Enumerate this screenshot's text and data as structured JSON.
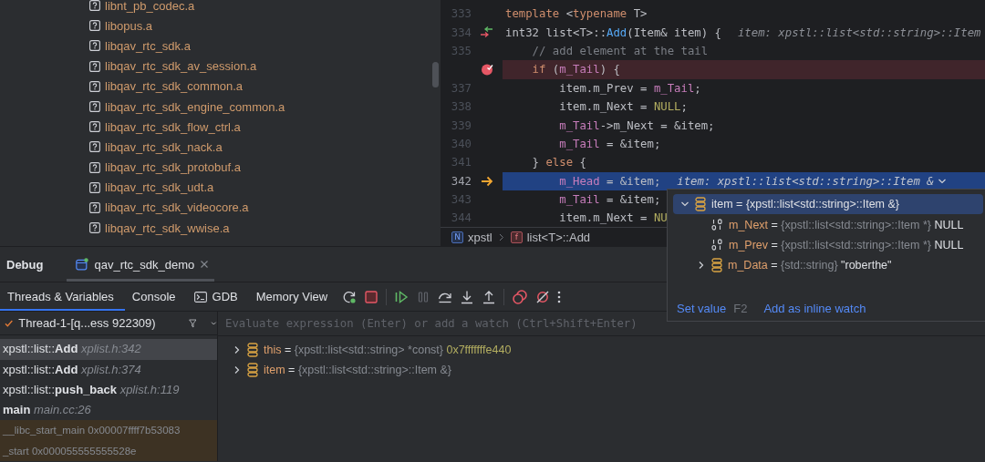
{
  "file_tree": {
    "items": [
      {
        "name": "libnt_pb_codec.a"
      },
      {
        "name": "libopus.a"
      },
      {
        "name": "libqav_rtc_sdk.a"
      },
      {
        "name": "libqav_rtc_sdk_av_session.a"
      },
      {
        "name": "libqav_rtc_sdk_common.a"
      },
      {
        "name": "libqav_rtc_sdk_engine_common.a"
      },
      {
        "name": "libqav_rtc_sdk_flow_ctrl.a"
      },
      {
        "name": "libqav_rtc_sdk_nack.a"
      },
      {
        "name": "libqav_rtc_sdk_protobuf.a"
      },
      {
        "name": "libqav_rtc_sdk_udt.a"
      },
      {
        "name": "libqav_rtc_sdk_videocore.a"
      },
      {
        "name": "libqav_rtc_sdk_wwise.a"
      }
    ]
  },
  "editor": {
    "lines": [
      {
        "number": "333",
        "kind": "plain",
        "segments": [
          {
            "kind": "keyword",
            "text": "template "
          },
          {
            "kind": "text",
            "text": "<"
          },
          {
            "kind": "keyword",
            "text": "typename"
          },
          {
            "kind": "text",
            "text": " T>"
          }
        ]
      },
      {
        "number": "334",
        "kind": "step",
        "segments": [
          {
            "kind": "text",
            "text": "int32 list<T>::"
          },
          {
            "kind": "function",
            "text": "Add"
          },
          {
            "kind": "text",
            "text": "(Item& item) {"
          }
        ],
        "hint": "item: xpstl::list<std::string>::Item",
        "hint_expandable": false
      },
      {
        "number": "335",
        "kind": "plain",
        "segments": [
          {
            "kind": "comment",
            "text": "    // add element at the tail"
          }
        ]
      },
      {
        "kind": "breakpoint",
        "segments": [
          {
            "kind": "keyword",
            "text": "    if "
          },
          {
            "kind": "text",
            "text": "("
          },
          {
            "kind": "field",
            "text": "m_Tail"
          },
          {
            "kind": "text",
            "text": ") {"
          }
        ]
      },
      {
        "number": "337",
        "kind": "plain",
        "segments": [
          {
            "kind": "text",
            "text": "        item.m_Prev = "
          },
          {
            "kind": "field",
            "text": "m_Tail"
          },
          {
            "kind": "text",
            "text": ";"
          }
        ]
      },
      {
        "number": "338",
        "kind": "plain",
        "segments": [
          {
            "kind": "text",
            "text": "        item.m_Next = "
          },
          {
            "kind": "constant",
            "text": "NULL"
          },
          {
            "kind": "text",
            "text": ";"
          }
        ]
      },
      {
        "number": "339",
        "kind": "plain",
        "segments": [
          {
            "kind": "field",
            "text": "        m_Tail"
          },
          {
            "kind": "text",
            "text": "->m_Next = &item;"
          }
        ]
      },
      {
        "number": "340",
        "kind": "plain",
        "segments": [
          {
            "kind": "field",
            "text": "        m_Tail"
          },
          {
            "kind": "text",
            "text": " = &item;"
          }
        ]
      },
      {
        "number": "341",
        "kind": "plain",
        "segments": [
          {
            "kind": "text",
            "text": "    } "
          },
          {
            "kind": "keyword",
            "text": "else"
          },
          {
            "kind": "text",
            "text": " {"
          }
        ]
      },
      {
        "number": "342",
        "kind": "execution",
        "segments": [
          {
            "kind": "field",
            "text": "        m_Head"
          },
          {
            "kind": "text",
            "text": " = &item;"
          }
        ],
        "hint": "item: xpstl::list<std::string>::Item &",
        "hint_expandable": true
      },
      {
        "number": "343",
        "kind": "plain",
        "segments": [
          {
            "kind": "field",
            "text": "        m_Tail"
          },
          {
            "kind": "text",
            "text": " = &item;"
          }
        ]
      },
      {
        "number": "344",
        "kind": "plain",
        "segments": [
          {
            "kind": "text",
            "text": "        item.m_Next = "
          },
          {
            "kind": "constant",
            "text": "NU"
          }
        ]
      }
    ],
    "breadcrumbs": [
      {
        "kind": "namespace",
        "badge": "N",
        "label": "xpstl"
      },
      {
        "kind": "function",
        "badge": "f",
        "label": "list<T>::Add"
      }
    ]
  },
  "debug": {
    "title": "Debug",
    "sessions": [
      {
        "label": "qav_rtc_sdk_demo",
        "selected": true
      }
    ],
    "tabs": [
      {
        "kind": "plain",
        "label": "Threads & Variables",
        "selected": true
      },
      {
        "kind": "plain",
        "label": "Console",
        "selected": false
      },
      {
        "kind": "terminal",
        "label": "GDB",
        "selected": false
      },
      {
        "kind": "plain",
        "label": "Memory View",
        "selected": false
      }
    ],
    "toolbar": [
      {
        "kind": "rerun",
        "disabled": false
      },
      {
        "kind": "stop",
        "disabled": false
      },
      {
        "kind": "resume",
        "disabled": false
      },
      {
        "kind": "pause",
        "disabled": true
      },
      {
        "kind": "step-over",
        "disabled": false
      },
      {
        "kind": "step-into",
        "disabled": false
      },
      {
        "kind": "step-out",
        "disabled": false
      },
      {
        "kind": "breakpoints",
        "disabled": false
      },
      {
        "kind": "mute-breakpoints",
        "disabled": false
      },
      {
        "kind": "more",
        "disabled": false
      }
    ],
    "thread": {
      "label": "Thread-1-[q...ess 922309)"
    },
    "evaluate": {
      "placeholder": "Evaluate expression (Enter) or add a watch (Ctrl+Shift+Enter)"
    },
    "frames": [
      {
        "kind": "user",
        "text": "xpstl::list::**Add** *xplist.h:342*",
        "selected": true
      },
      {
        "kind": "user",
        "text": "xpstl::list::**Add** *xplist.h:374*",
        "selected": false
      },
      {
        "kind": "user",
        "text": "xpstl::list::**push_back** *xplist.h:119*",
        "selected": false
      },
      {
        "kind": "user",
        "text": "**main** *main.cc:26*",
        "selected": false
      },
      {
        "kind": "library",
        "text": "__libc_start_main 0x00007ffff7b53083",
        "selected": false
      },
      {
        "kind": "library",
        "text": "_start 0x000055555555528e",
        "selected": false
      }
    ],
    "variables": [
      {
        "name": "this",
        "sign": "=",
        "type": "{xpstl::list<std::string> *const}",
        "value": "0x7fffffffe440",
        "expanded": false
      },
      {
        "name": "item",
        "sign": "=",
        "type": "{xpstl::list<std::string>::Item &}",
        "expanded": false
      }
    ]
  },
  "popup": {
    "root": {
      "name": "item",
      "sign": "=",
      "type": "{xpstl::list<std::string>::Item &}",
      "expanded": true,
      "selected": true,
      "children": [
        {
          "kind": "primitive",
          "name": "m_Next",
          "sign": "=",
          "type": "{xpstl::list<std::string>::Item *}",
          "value": "NULL"
        },
        {
          "kind": "primitive",
          "name": "m_Prev",
          "sign": "=",
          "type": "{xpstl::list<std::string>::Item *}",
          "value": "NULL"
        },
        {
          "kind": "struct",
          "name": "m_Data",
          "sign": "=",
          "type": "{std::string}",
          "value": "\"roberthe\"",
          "expanded": false
        }
      ]
    },
    "actions": [
      {
        "label": "Set value",
        "shortcut": "F2"
      },
      {
        "label": "Add as inline watch"
      }
    ]
  }
}
